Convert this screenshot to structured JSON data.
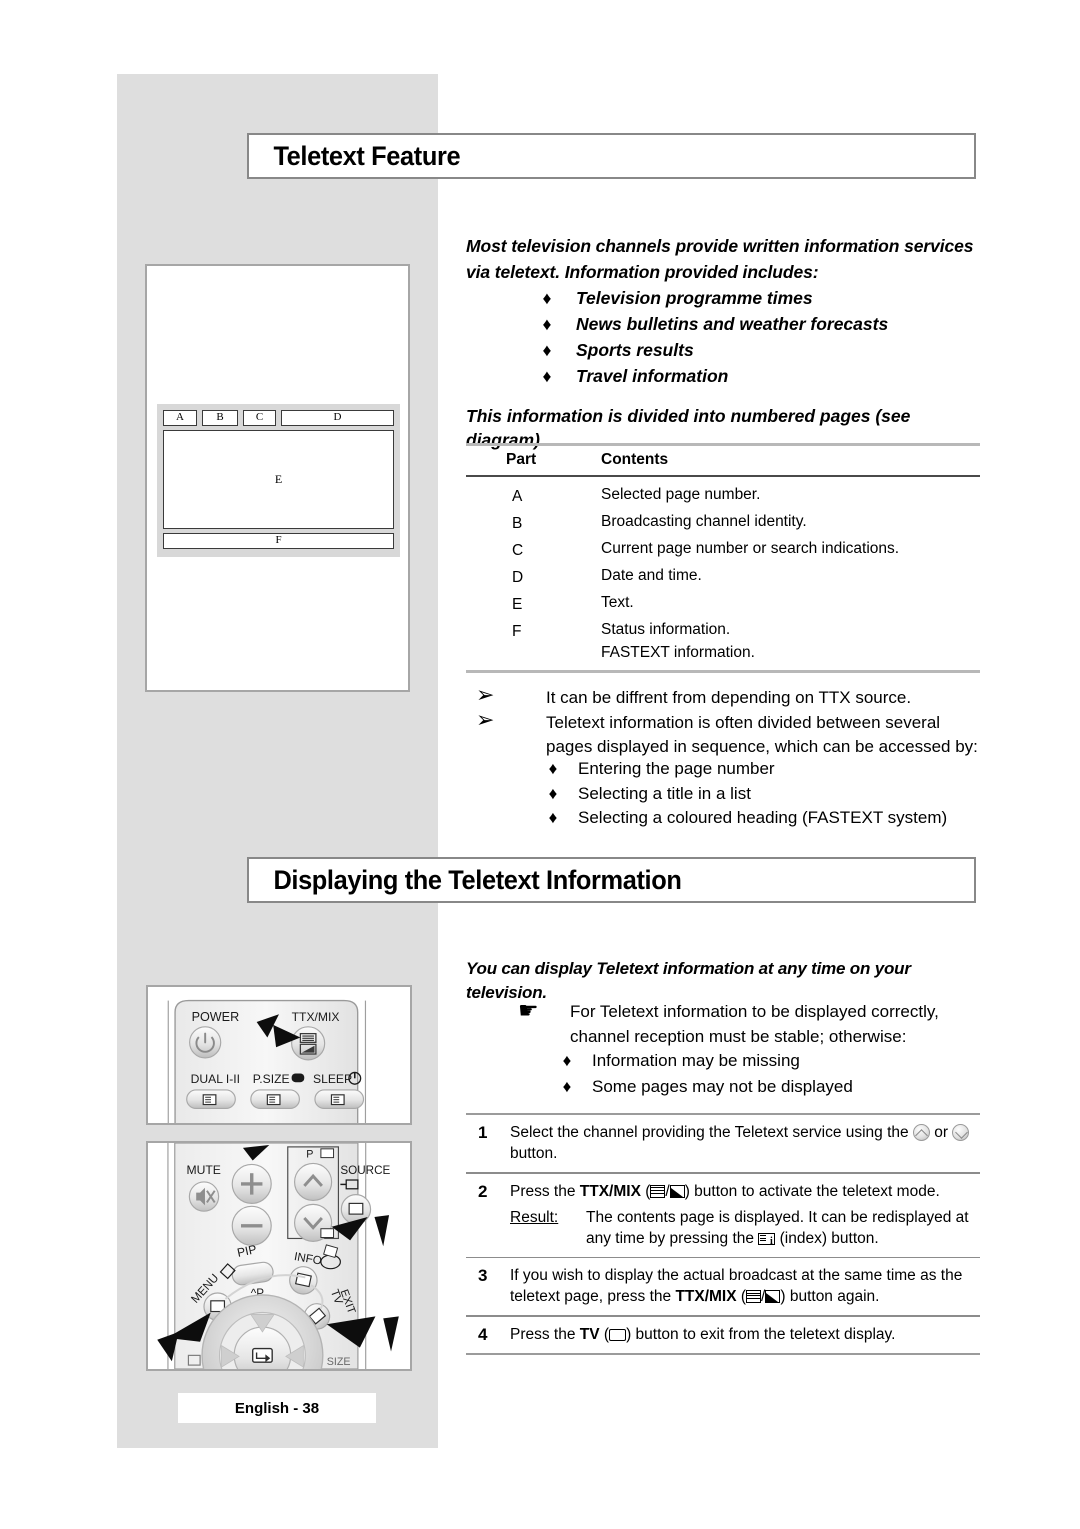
{
  "document": {
    "footer_label": "English - 38"
  },
  "sections": [
    {
      "id": "teletext-feature",
      "title": "Teletext Feature"
    },
    {
      "id": "displaying-info",
      "title": "Displaying the Teletext Information"
    }
  ],
  "feature": {
    "intro": "Most television channels provide written information services via teletext. Information provided includes:",
    "bullets": [
      "Television programme times",
      "News bulletins and weather forecasts",
      "Sports results",
      "Travel information"
    ],
    "subline": "This information is divided into numbered pages (see diagram).",
    "table": {
      "headers": [
        "Part",
        "Contents"
      ],
      "rows": [
        {
          "part": "A",
          "contents": [
            "Selected page number."
          ]
        },
        {
          "part": "B",
          "contents": [
            "Broadcasting channel identity."
          ]
        },
        {
          "part": "C",
          "contents": [
            "Current page number or search indications."
          ]
        },
        {
          "part": "D",
          "contents": [
            "Date and time."
          ]
        },
        {
          "part": "E",
          "contents": [
            "Text."
          ]
        },
        {
          "part": "F",
          "contents": [
            "Status information.",
            "FASTEXT information."
          ]
        }
      ]
    },
    "notes": [
      "It can be  diffrent from depending on TTX source.",
      "Teletext information is often divided between several pages displayed in sequence, which can be accessed by:"
    ],
    "note_bullets": [
      "Entering the page number",
      "Selecting a title in a list",
      "Selecting a coloured heading (FASTEXT system)"
    ]
  },
  "displaying": {
    "intro": "You can display Teletext information at any time on your television.",
    "hand_note": "For Teletext information to be displayed correctly, channel reception must be stable; otherwise:",
    "hand_bullets": [
      "Information may be missing",
      "Some pages may not be displayed"
    ],
    "steps": [
      {
        "number": "1",
        "text_before": "Select the channel providing the Teletext service using the ",
        "text_mid": " or ",
        "text_after": " button."
      },
      {
        "number": "2",
        "text_before": "Press the ",
        "bold": "TTX/MIX",
        "text_after": " button to activate the teletext mode.",
        "result_label": "Result:",
        "result_before": "The contents page is displayed. It can be redisplayed at any time by pressing the ",
        "result_after": " (index) button."
      },
      {
        "number": "3",
        "text_before": "If you wish to display the actual broadcast at the same time as the teletext page, press the ",
        "bold": "TTX/MIX",
        "text_after": " button again."
      },
      {
        "number": "4",
        "text_before": "Press the ",
        "bold": "TV",
        "text_after": " button to exit from the teletext display."
      }
    ]
  },
  "figures": {
    "teletext_diagram": {
      "labels": {
        "a": "A",
        "b": "B",
        "c": "C",
        "d": "D",
        "e": "E",
        "f": "F"
      }
    },
    "remote_top": {
      "power_label": "POWER",
      "ttxmix_label": "TTX/MIX",
      "dual_label": "DUAL I-II",
      "psize_label": "P.SIZE",
      "sleep_label": "SLEEP"
    },
    "remote_bottom": {
      "mute_label": "MUTE",
      "p_label": "P",
      "source_label": "SOURCE",
      "pip_label": "PIP",
      "info_label": "INFO",
      "menu_label": "MENU",
      "exit_label": "EXIT",
      "tv_label": "TV",
      "channel_label": "^P",
      "size_label": "SIZE"
    }
  },
  "glyphs": {
    "diamond": "♦",
    "arrow": "➢",
    "hand": "☛"
  },
  "colors": {
    "panel_grey": "#dedede",
    "bar_border": "#888888",
    "rule_light": "#b8b8b8",
    "rule_dark": "#4a4a4a"
  }
}
